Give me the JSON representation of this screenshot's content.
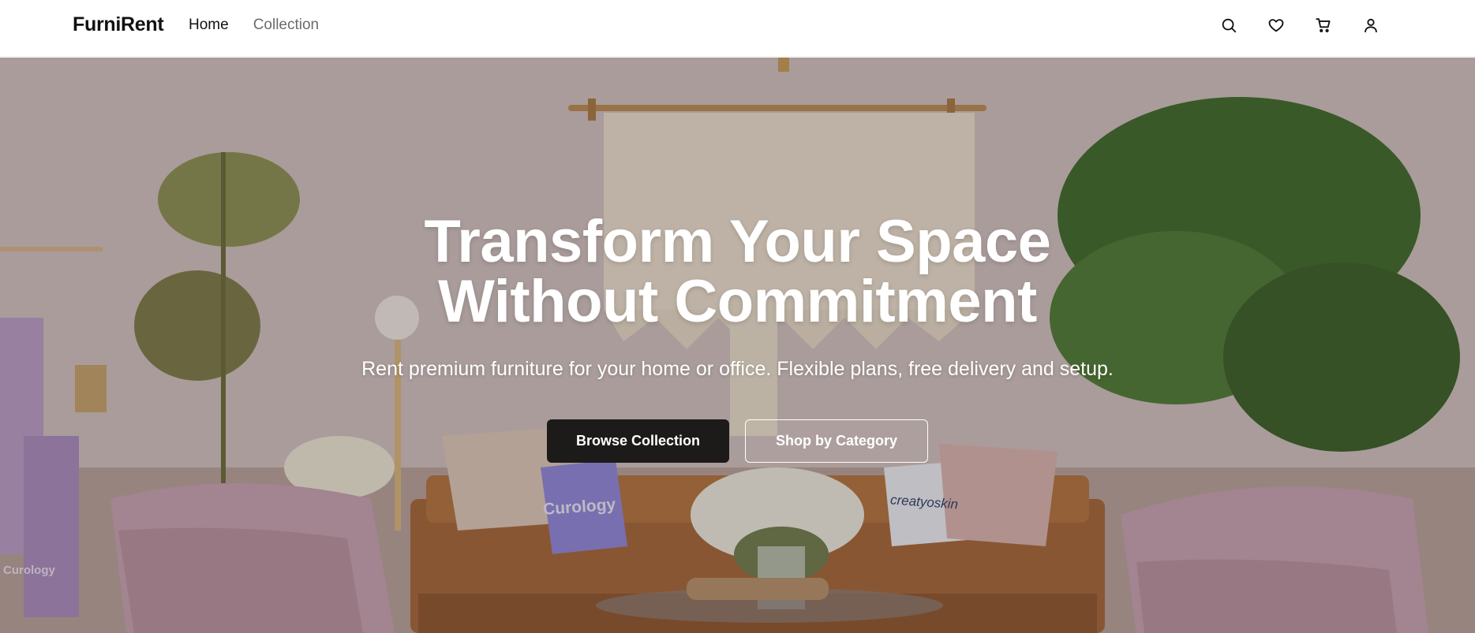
{
  "header": {
    "logo": "FurniRent",
    "nav": [
      {
        "label": "Home"
      },
      {
        "label": "Collection"
      }
    ],
    "icons": [
      "search-icon",
      "heart-icon",
      "cart-icon",
      "user-icon"
    ]
  },
  "hero": {
    "title_line1": "Transform Your Space",
    "title_line2": "Without Commitment",
    "subtitle": "Rent premium furniture for your home or office. Flexible plans, free delivery and setup.",
    "primary_button": "Browse Collection",
    "secondary_button": "Shop by Category",
    "pillow_text_left": "Curology",
    "pillow_text_right": "creatyoskin",
    "towel_text": "Curology"
  },
  "colors": {
    "primary_button_bg": "#1d1b1a",
    "text_dark": "#111111",
    "nav_muted": "#6b6b6b",
    "hero_text": "#ffffff"
  }
}
